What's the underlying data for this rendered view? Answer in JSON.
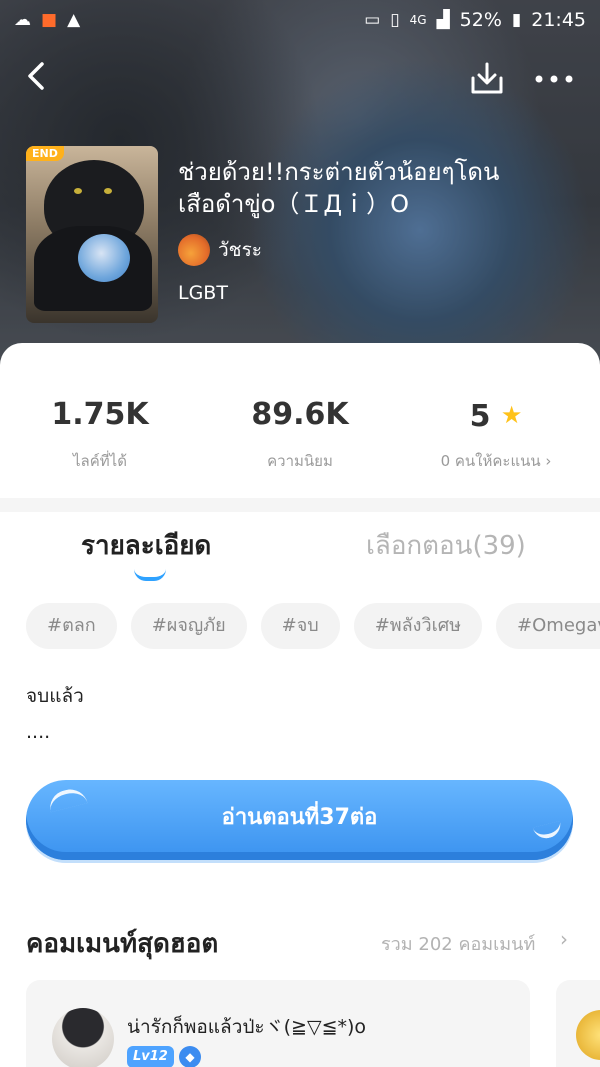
{
  "status_bar": {
    "battery_percent": "52%",
    "time": "21:45",
    "network": "4G"
  },
  "header": {
    "back_icon": "chevron-left-icon",
    "download_icon": "download-icon",
    "more_icon": "more-horizontal-icon"
  },
  "novel": {
    "cover_badge": "END",
    "title": "ช่วยด้วย!!กระต่ายตัวน้อยๆโดนเสือดำขู่o（ＩДｉ）O",
    "author": "วัชระ",
    "category": "LGBT"
  },
  "stats": [
    {
      "value": "1.75K",
      "label": "ไลค์ที่ได้"
    },
    {
      "value": "89.6K",
      "label": "ความนิยม"
    },
    {
      "value": "5",
      "label": "0 คนให้คะแนน"
    }
  ],
  "tabs": {
    "details": "รายละเอียด",
    "chapters": "เลือกตอน(39)"
  },
  "tags": [
    "#ตลก",
    "#ผจญภัย",
    "#จบ",
    "#พลังวิเศษ",
    "#Omegaverse"
  ],
  "description": {
    "line1": "จบแล้ว",
    "line2": "...."
  },
  "read_button": "อ่านตอนที่37ต่อ",
  "hot_comments": {
    "title": "คอมเมนท์สุดฮอต",
    "total": "รวม 202 คอมเมนท์",
    "items": [
      {
        "name": "น่ารักก็พอแล้วป่ะヾ(≧▽≦*)o",
        "level": "Lv12"
      }
    ]
  },
  "colors": {
    "accent": "#3a92ef",
    "star": "#ffc21a",
    "badge": "#ffb11b"
  }
}
